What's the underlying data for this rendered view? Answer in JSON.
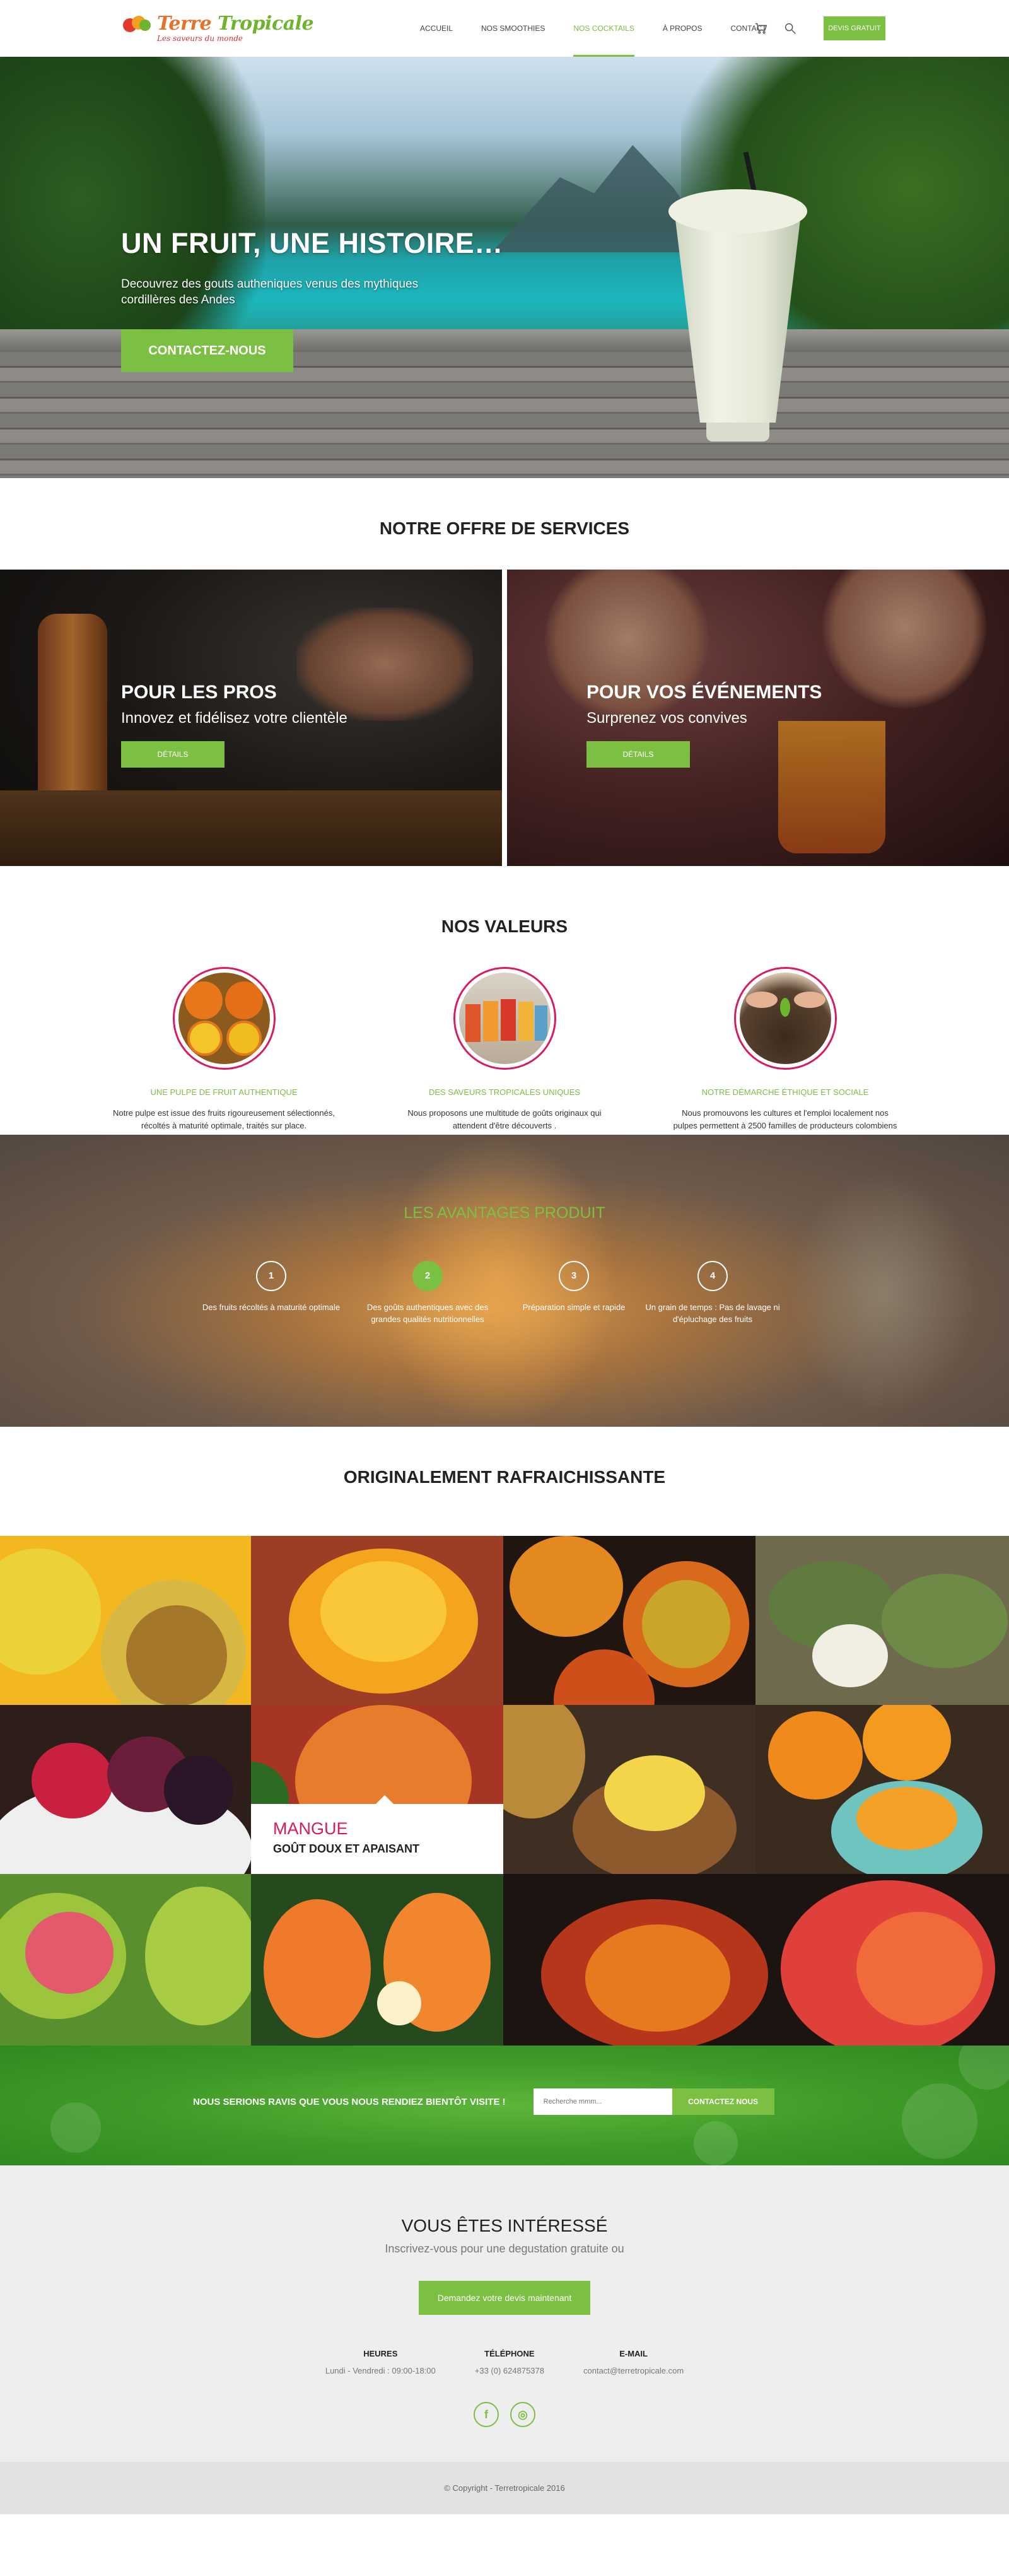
{
  "brand": {
    "name_part1": "Terre",
    "name_part2": "Tropicale",
    "tagline": "Les saveurs du monde"
  },
  "nav": {
    "items": [
      {
        "label": "Accueil"
      },
      {
        "label": "Nos Smoothies"
      },
      {
        "label": "Nos Cocktails"
      },
      {
        "label": "À Propos"
      },
      {
        "label": "Contact"
      }
    ],
    "active_index": 2,
    "cart_icon": "cart-icon",
    "search_icon": "search-icon",
    "devis_label": "Devis Gratuit"
  },
  "hero": {
    "title": "UN FRUIT, UNE HISTOIRE…",
    "subtitle": "Decouvrez des gouts autheniques venus des mythiques cordillères des Andes",
    "cta_label": "Contactez-nous"
  },
  "services": {
    "title": "Notre offre de services",
    "cards": [
      {
        "title": "Pour les pros",
        "subtitle": "Innovez et fidélisez votre clientèle",
        "button": "Détails"
      },
      {
        "title": "Pour vos événements",
        "subtitle": "Surprenez vos convives",
        "button": "Détails"
      }
    ]
  },
  "valeurs": {
    "title": "Nos valeurs",
    "items": [
      {
        "title": "Une pulpe de fruit authentique",
        "text": "Notre pulpe est issue des fruits rigoureusement sélectionnés, récoltés à maturité optimale, traités sur place."
      },
      {
        "title": "Des saveurs tropicales uniques",
        "text": "Nous proposons une multitude de goûts originaux qui attendent d'être découverts ."
      },
      {
        "title": "Notre démarche éthique et sociale",
        "text": "Nous promouvons les cultures et l'emploi localement nos pulpes permettent à 2500 familles de producteurs colombiens"
      }
    ]
  },
  "avantages": {
    "title": "Les avantages produit",
    "steps": [
      {
        "num": "1",
        "text": "Des fruits récoltés à maturité optimale",
        "active": false
      },
      {
        "num": "2",
        "text": "Des goûts authentiques avec des grandes qualités nutritionnelles",
        "active": true
      },
      {
        "num": "3",
        "text": "Préparation simple et rapide",
        "active": false
      },
      {
        "num": "4",
        "text": "Un grain de temps : Pas de lavage ni d'épluchage des fruits",
        "active": false
      }
    ]
  },
  "original": {
    "title": "Originalement rafraichissante",
    "highlight": {
      "name": "Mangue",
      "desc": "Goût doux et apaisant"
    }
  },
  "cta": {
    "text": "Nous serions ravis que vous nous rendiez bientôt visite !",
    "input_placeholder": "Recherche mmm...",
    "button": "Contactez nous"
  },
  "contact": {
    "title": "Vous êtes intéressé",
    "subtitle": "Inscrivez-vous pour une degustation gratuite ou",
    "button": "Demandez votre devis maintenant",
    "infos": [
      {
        "label": "Heures",
        "value": "Lundi - Vendredi : 09:00-18:00"
      },
      {
        "label": "Téléphone",
        "value": "+33 (0) 624875378"
      },
      {
        "label": "E-mail",
        "value": "contact@terretropicale.com"
      }
    ],
    "socials": [
      {
        "icon": "facebook-icon",
        "glyph": "f"
      },
      {
        "icon": "instagram-icon",
        "glyph": "◎"
      }
    ]
  },
  "footer": {
    "copyright": "© Copyright - Terretropicale 2016"
  },
  "colors": {
    "accent": "#7bc043",
    "pink": "#d81b60",
    "logo_orange": "#e8702a"
  }
}
